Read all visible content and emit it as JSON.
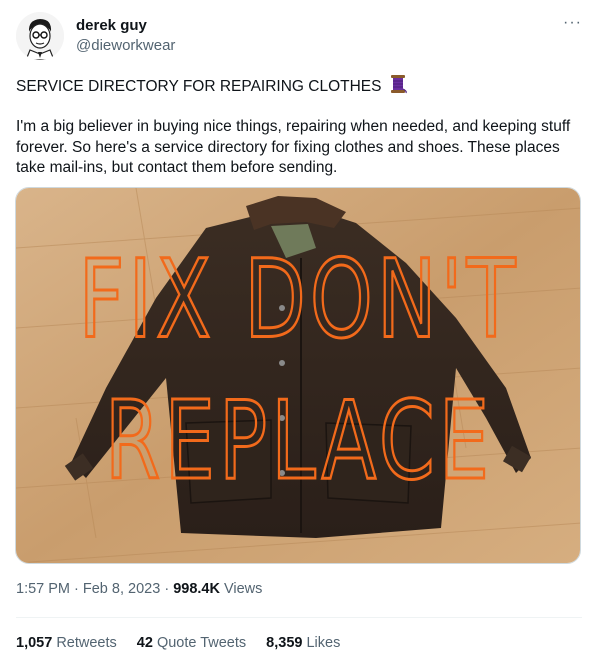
{
  "author": {
    "name": "derek guy",
    "handle": "@dieworkwear",
    "avatar_icon": "avatar-illustration-icon"
  },
  "more_icon_glyph": "···",
  "tweet": {
    "title": "SERVICE DIRECTORY FOR REPAIRING CLOTHES",
    "title_icon": "thread-spool-icon",
    "body": "I'm a big believer in buying nice things, repairing when needed, and keeping stuff forever. So here's a service directory for fixing clothes and shoes. These places take mail-ins, but contact them before sending."
  },
  "media": {
    "overlay_line1": "FIX DON'T",
    "overlay_line2": "REPLACE",
    "overlay_color": "#f26a1b"
  },
  "meta": {
    "time": "1:57 PM",
    "date": "Feb 8, 2023",
    "views_count": "998.4K",
    "views_label": "Views"
  },
  "stats": {
    "retweets_count": "1,057",
    "retweets_label": "Retweets",
    "quotes_count": "42",
    "quotes_label": "Quote Tweets",
    "likes_count": "8,359",
    "likes_label": "Likes"
  }
}
